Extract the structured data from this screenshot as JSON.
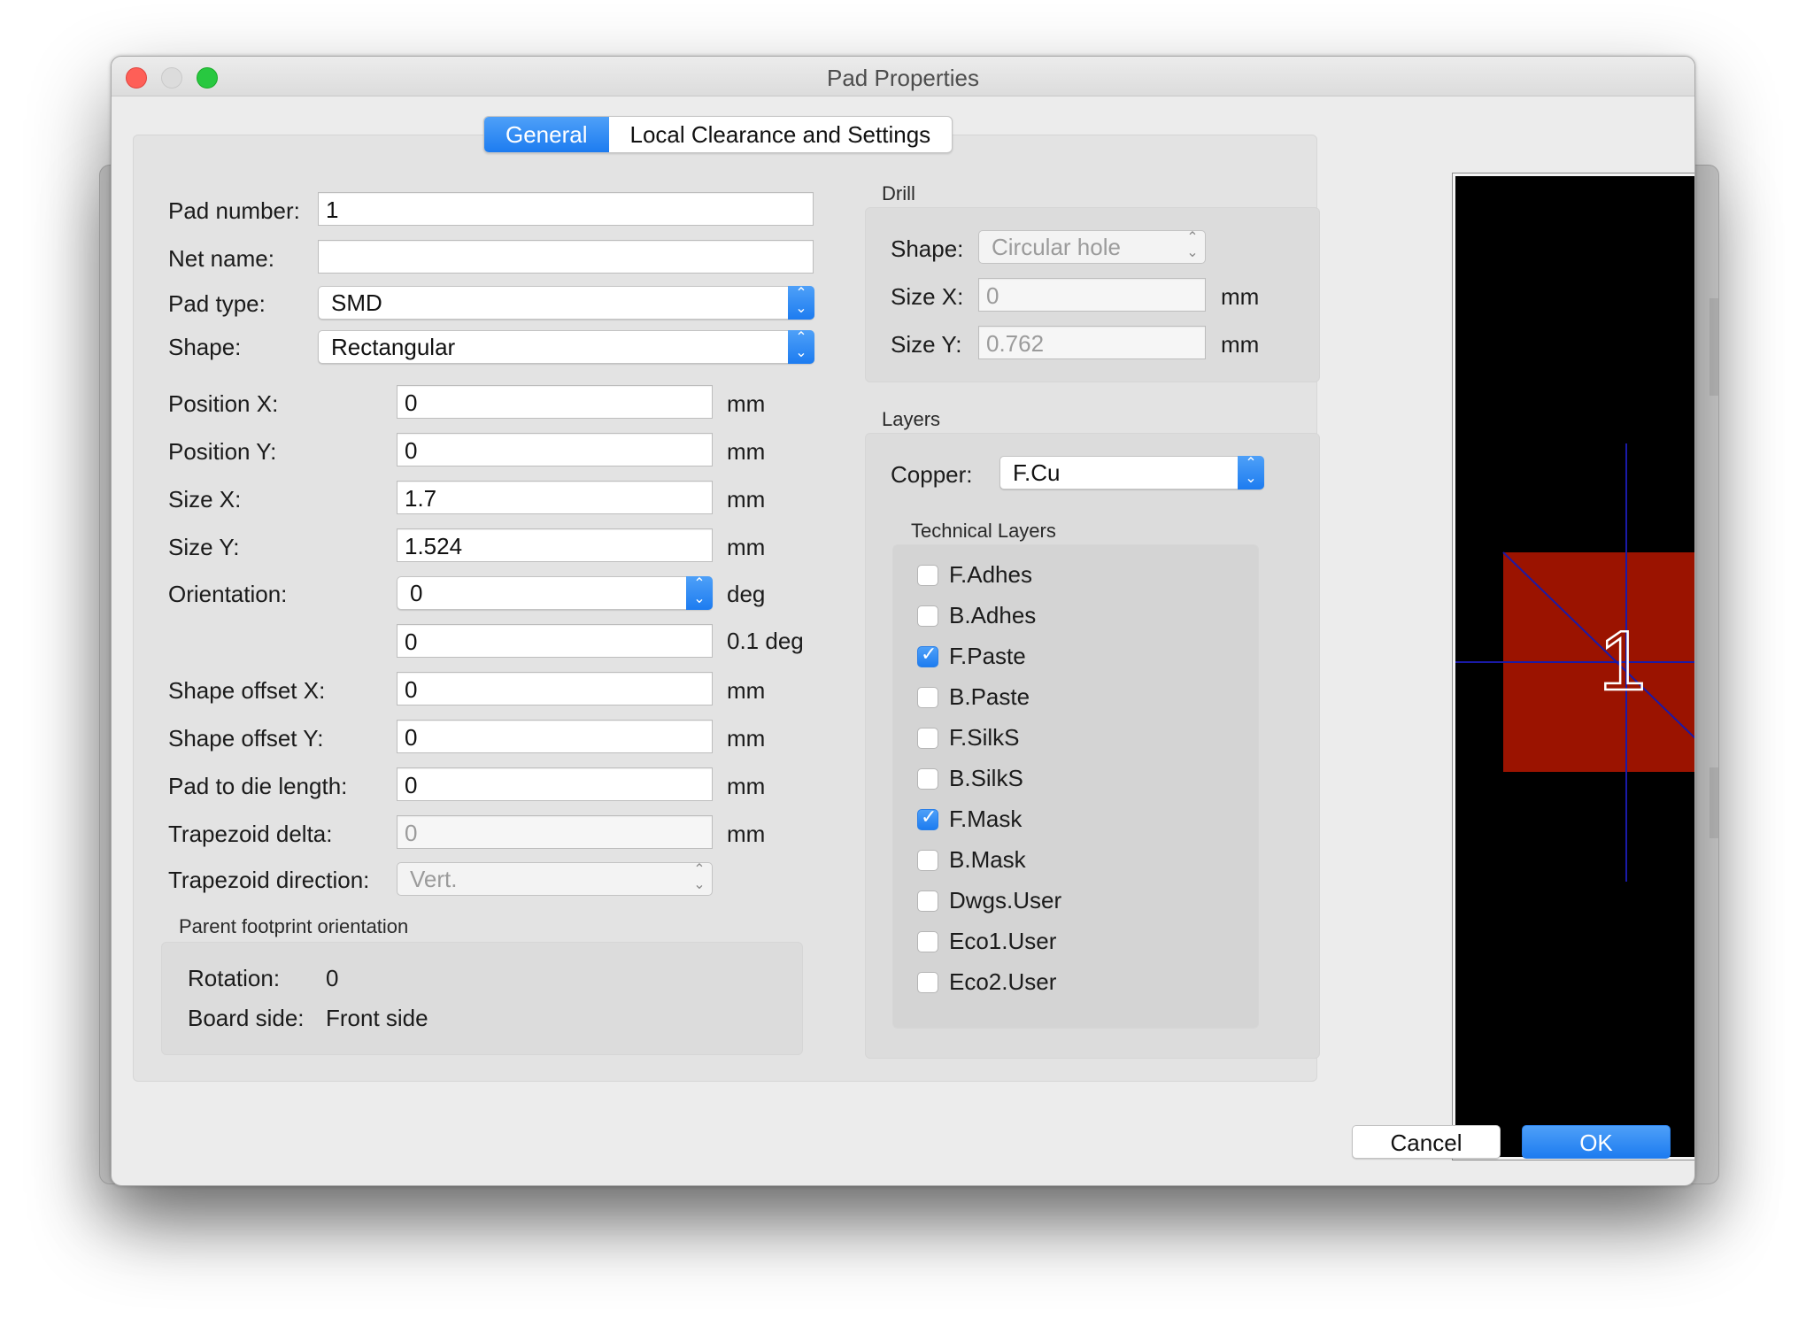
{
  "window": {
    "title": "Pad Properties",
    "tabs": [
      "General",
      "Local Clearance and Settings"
    ]
  },
  "general": {
    "pad_number": {
      "label": "Pad number:",
      "value": "1"
    },
    "net_name": {
      "label": "Net name:",
      "value": ""
    },
    "pad_type": {
      "label": "Pad type:",
      "value": "SMD"
    },
    "shape": {
      "label": "Shape:",
      "value": "Rectangular"
    },
    "position_x": {
      "label": "Position X:",
      "value": "0",
      "unit": "mm"
    },
    "position_y": {
      "label": "Position Y:",
      "value": "0",
      "unit": "mm"
    },
    "size_x": {
      "label": "Size X:",
      "value": "1.7",
      "unit": "mm"
    },
    "size_y": {
      "label": "Size Y:",
      "value": "1.524",
      "unit": "mm"
    },
    "orientation": {
      "label": "Orientation:",
      "value": "0",
      "unit": "deg"
    },
    "orientation_fine": {
      "value": "0",
      "unit": "0.1 deg"
    },
    "shape_offset_x": {
      "label": "Shape offset X:",
      "value": "0",
      "unit": "mm"
    },
    "shape_offset_y": {
      "label": "Shape offset Y:",
      "value": "0",
      "unit": "mm"
    },
    "pad_to_die": {
      "label": "Pad to die length:",
      "value": "0",
      "unit": "mm"
    },
    "trapezoid_delta": {
      "label": "Trapezoid delta:",
      "value": "0",
      "unit": "mm"
    },
    "trapezoid_direction": {
      "label": "Trapezoid direction:",
      "value": "Vert."
    }
  },
  "parent": {
    "header": "Parent footprint orientation",
    "rotation_label": "Rotation:",
    "rotation_value": "0",
    "side_label": "Board side:",
    "side_value": "Front side"
  },
  "drill": {
    "header": "Drill",
    "shape_label": "Shape:",
    "shape_value": "Circular hole",
    "size_x_label": "Size X:",
    "size_x_value": "0",
    "size_y_label": "Size Y:",
    "size_y_value": "0.762",
    "unit": "mm"
  },
  "layers": {
    "header": "Layers",
    "copper_label": "Copper:",
    "copper_value": "F.Cu",
    "technical_header": "Technical Layers",
    "items": [
      {
        "name": "F.Adhes",
        "checked": false
      },
      {
        "name": "B.Adhes",
        "checked": false
      },
      {
        "name": "F.Paste",
        "checked": true
      },
      {
        "name": "B.Paste",
        "checked": false
      },
      {
        "name": "F.SilkS",
        "checked": false
      },
      {
        "name": "B.SilkS",
        "checked": false
      },
      {
        "name": "F.Mask",
        "checked": true
      },
      {
        "name": "B.Mask",
        "checked": false
      },
      {
        "name": "Dwgs.User",
        "checked": false
      },
      {
        "name": "Eco1.User",
        "checked": false
      },
      {
        "name": "Eco2.User",
        "checked": false
      }
    ]
  },
  "preview": {
    "pad_label": "1",
    "pad_color": "#9b1300",
    "axis_color": "#1a1aa8"
  },
  "buttons": {
    "cancel": "Cancel",
    "ok": "OK"
  },
  "colors": {
    "accent": "#1d7cf0"
  }
}
